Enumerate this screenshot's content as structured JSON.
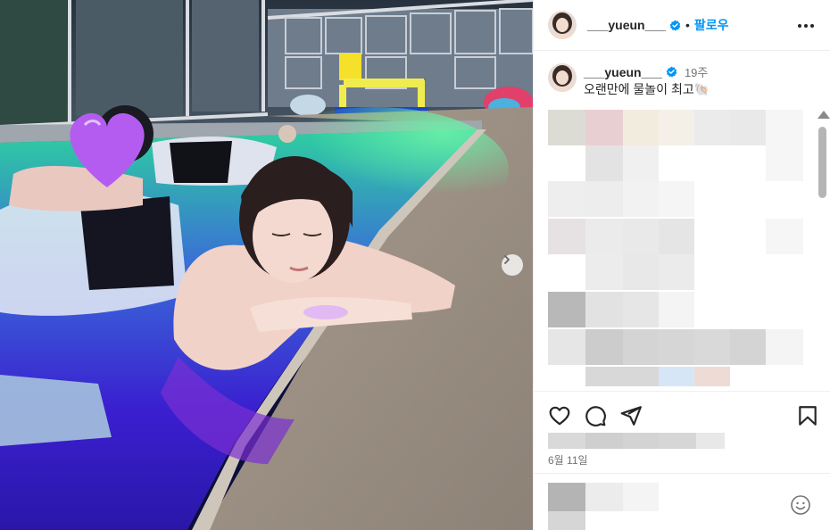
{
  "post": {
    "username": "___yueun___",
    "follow_label": "팔로우",
    "separator": "•",
    "caption_username": "___yueun___",
    "caption_time": "19주",
    "caption_text": "오랜만에 물놀이 최고",
    "caption_emoji": "🐚",
    "date": "6월 11일"
  },
  "colors": {
    "accent": "#0095f6",
    "verified": "#0095f6",
    "text": "#262626",
    "muted": "#737373"
  },
  "icons": {
    "more": "more-options-icon",
    "like": "heart-icon",
    "comment": "comment-icon",
    "share": "send-icon",
    "save": "bookmark-icon",
    "emoji": "emoji-icon",
    "next": "chevron-right-icon",
    "verified": "verified-badge-icon",
    "heart_sticker": "purple-heart-icon"
  }
}
